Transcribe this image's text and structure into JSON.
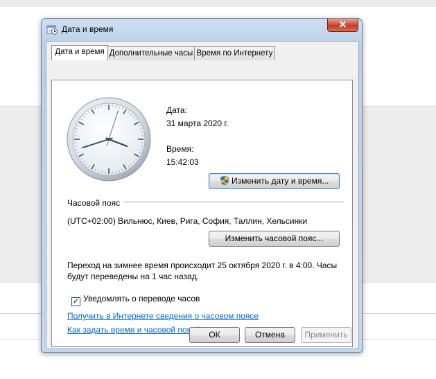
{
  "window": {
    "title": "Дата и время",
    "close_glyph": "✕"
  },
  "tabs": [
    {
      "label": "Дата и время",
      "active": true
    },
    {
      "label": "Дополнительные часы",
      "active": false
    },
    {
      "label": "Время по Интернету",
      "active": false
    }
  ],
  "clock": {
    "hours": 15,
    "minutes": 42,
    "seconds": 3
  },
  "date": {
    "label": "Дата:",
    "value": "31 марта 2020 г."
  },
  "time": {
    "label": "Время:",
    "value": "15:42:03"
  },
  "buttons": {
    "change_datetime": "Изменить дату и время...",
    "change_timezone": "Изменить часовой пояс...",
    "ok": "ОК",
    "cancel": "Отмена",
    "apply": "Применить"
  },
  "timezone": {
    "label": "Часовой пояс",
    "value": "(UTC+02:00) Вильнюс, Киев, Рига, София, Таллин, Хельсинки"
  },
  "dst_info": {
    "line1": "Переход на зимнее время происходит 25 октября 2020 г. в 4:00. Часы",
    "line2": "будут переведены на 1 час назад."
  },
  "notify": {
    "label": "Уведомлять о переводе часов",
    "checked": true,
    "check_glyph": "✓"
  },
  "links": {
    "tz_info": "Получить в Интернете сведения о часовом поясе",
    "how_to": "Как задать время и часовой пояс?"
  },
  "colors": {
    "link": "#0066cc",
    "close_button": "#c23c24",
    "title_bar": "#b9d0ea"
  },
  "icons": {
    "title": "clock-calendar-icon",
    "shield": "uac-shield-icon",
    "close": "close-icon"
  }
}
